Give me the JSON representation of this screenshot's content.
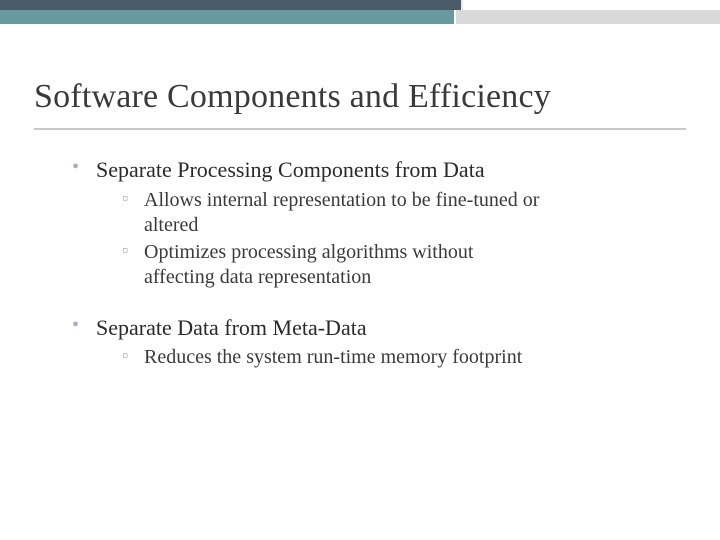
{
  "slide": {
    "title": "Software Components and Efficiency",
    "bullets": [
      {
        "text": "Separate Processing Components from Data",
        "sub": [
          "Allows internal representation to be fine-tuned or altered",
          "Optimizes processing algorithms without affecting data representation"
        ]
      },
      {
        "text": "Separate Data from Meta-Data",
        "sub": [
          "Reduces the system run-time memory footprint"
        ]
      }
    ]
  }
}
